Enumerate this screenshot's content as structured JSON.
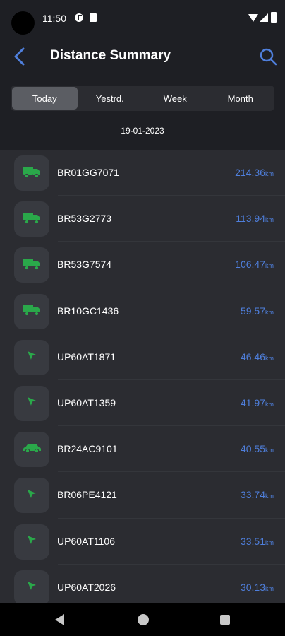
{
  "status_bar": {
    "time": "11:50"
  },
  "app_bar": {
    "title": "Distance Summary",
    "back_icon": "chevron-left-icon",
    "search_icon": "search-icon"
  },
  "tabs": [
    {
      "label": "Today",
      "active": true
    },
    {
      "label": "Yestrd.",
      "active": false
    },
    {
      "label": "Week",
      "active": false
    },
    {
      "label": "Month",
      "active": false
    }
  ],
  "date": "19-01-2023",
  "colors": {
    "accent_blue": "#4f7fdc",
    "icon_green": "#2aa84a",
    "background": "#1e1f24",
    "list_background": "#2b2c31"
  },
  "vehicles": [
    {
      "plate": "BR01GG7071",
      "distance": "214.36",
      "unit": "km",
      "icon": "truck-icon"
    },
    {
      "plate": "BR53G2773",
      "distance": "113.94",
      "unit": "km",
      "icon": "truck-icon"
    },
    {
      "plate": "BR53G7574",
      "distance": "106.47",
      "unit": "km",
      "icon": "truck-icon"
    },
    {
      "plate": "BR10GC1436",
      "distance": "59.57",
      "unit": "km",
      "icon": "truck-icon"
    },
    {
      "plate": "UP60AT1871",
      "distance": "46.46",
      "unit": "km",
      "icon": "navigation-arrow-icon"
    },
    {
      "plate": "UP60AT1359",
      "distance": "41.97",
      "unit": "km",
      "icon": "navigation-arrow-icon"
    },
    {
      "plate": "BR24AC9101",
      "distance": "40.55",
      "unit": "km",
      "icon": "car-icon"
    },
    {
      "plate": "BR06PE4121",
      "distance": "33.74",
      "unit": "km",
      "icon": "navigation-arrow-icon"
    },
    {
      "plate": "UP60AT1106",
      "distance": "33.51",
      "unit": "km",
      "icon": "navigation-arrow-icon"
    },
    {
      "plate": "UP60AT2026",
      "distance": "30.13",
      "unit": "km",
      "icon": "navigation-arrow-icon"
    }
  ]
}
